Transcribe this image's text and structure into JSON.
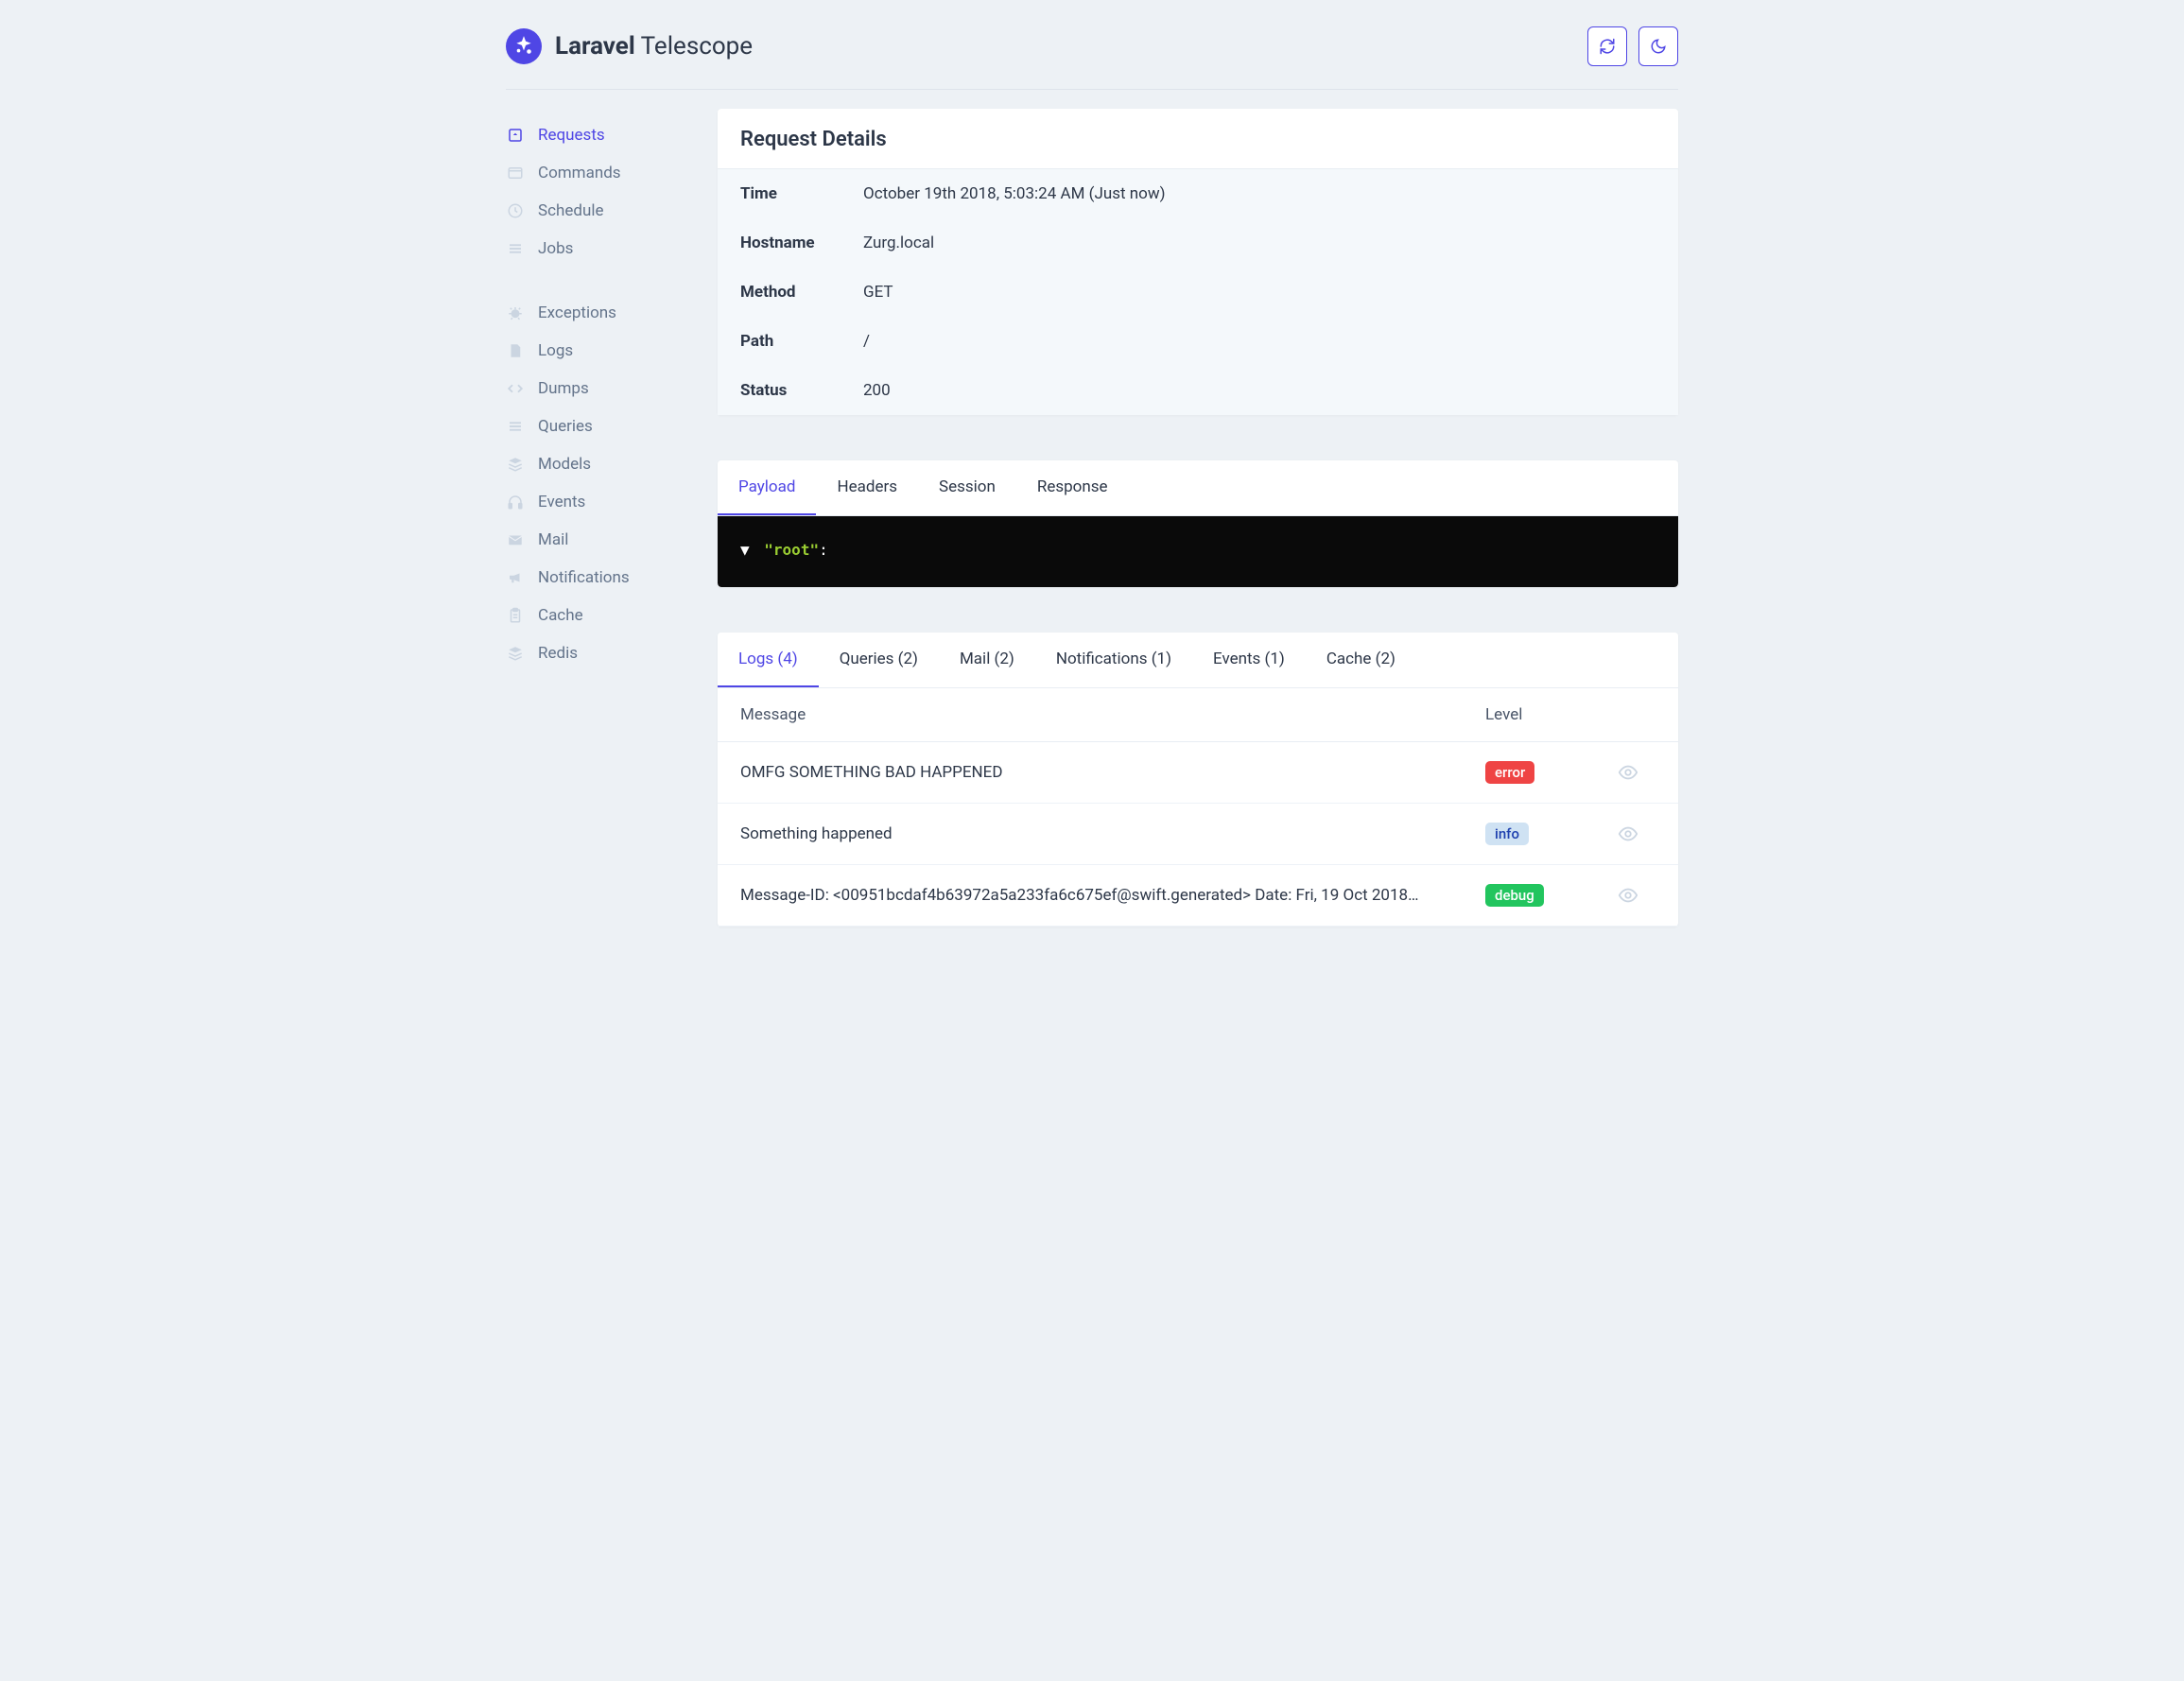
{
  "brand": {
    "bold": "Laravel",
    "light": " Telescope"
  },
  "sidebar": {
    "groups": [
      {
        "items": [
          {
            "label": "Requests",
            "icon": "package",
            "active": true
          },
          {
            "label": "Commands",
            "icon": "terminal",
            "active": false
          },
          {
            "label": "Schedule",
            "icon": "clock",
            "active": false
          },
          {
            "label": "Jobs",
            "icon": "bars",
            "active": false
          }
        ]
      },
      {
        "items": [
          {
            "label": "Exceptions",
            "icon": "bug",
            "active": false
          },
          {
            "label": "Logs",
            "icon": "file",
            "active": false
          },
          {
            "label": "Dumps",
            "icon": "code",
            "active": false
          },
          {
            "label": "Queries",
            "icon": "bars",
            "active": false
          },
          {
            "label": "Models",
            "icon": "layers",
            "active": false
          },
          {
            "label": "Events",
            "icon": "headphones",
            "active": false
          },
          {
            "label": "Mail",
            "icon": "mail",
            "active": false
          },
          {
            "label": "Notifications",
            "icon": "bullhorn",
            "active": false
          },
          {
            "label": "Cache",
            "icon": "clipboard",
            "active": false
          },
          {
            "label": "Redis",
            "icon": "layers",
            "active": false
          }
        ]
      }
    ]
  },
  "details": {
    "title": "Request Details",
    "rows": [
      {
        "label": "Time",
        "value": "October 19th 2018, 5:03:24 AM (Just now)"
      },
      {
        "label": "Hostname",
        "value": "Zurg.local"
      },
      {
        "label": "Method",
        "value": "GET"
      },
      {
        "label": "Path",
        "value": "/"
      },
      {
        "label": "Status",
        "value": "200"
      }
    ]
  },
  "payload_tabs": [
    {
      "label": "Payload",
      "active": true
    },
    {
      "label": "Headers",
      "active": false
    },
    {
      "label": "Session",
      "active": false
    },
    {
      "label": "Response",
      "active": false
    }
  ],
  "payload_json": {
    "root_key": "\"root\""
  },
  "related_tabs": [
    {
      "label": "Logs (4)",
      "active": true
    },
    {
      "label": "Queries (2)",
      "active": false
    },
    {
      "label": "Mail (2)",
      "active": false
    },
    {
      "label": "Notifications (1)",
      "active": false
    },
    {
      "label": "Events (1)",
      "active": false
    },
    {
      "label": "Cache (2)",
      "active": false
    }
  ],
  "logs_table": {
    "headers": {
      "message": "Message",
      "level": "Level"
    },
    "rows": [
      {
        "message": "OMFG SOMETHING BAD HAPPENED",
        "level": "error",
        "level_class": "error"
      },
      {
        "message": "Something happened",
        "level": "info",
        "level_class": "info"
      },
      {
        "message": "Message-ID: <00951bcdaf4b63972a5a233fa6c675ef@swift.generated> Date: Fri, 19 Oct 2018…",
        "level": "debug",
        "level_class": "debug"
      }
    ]
  }
}
